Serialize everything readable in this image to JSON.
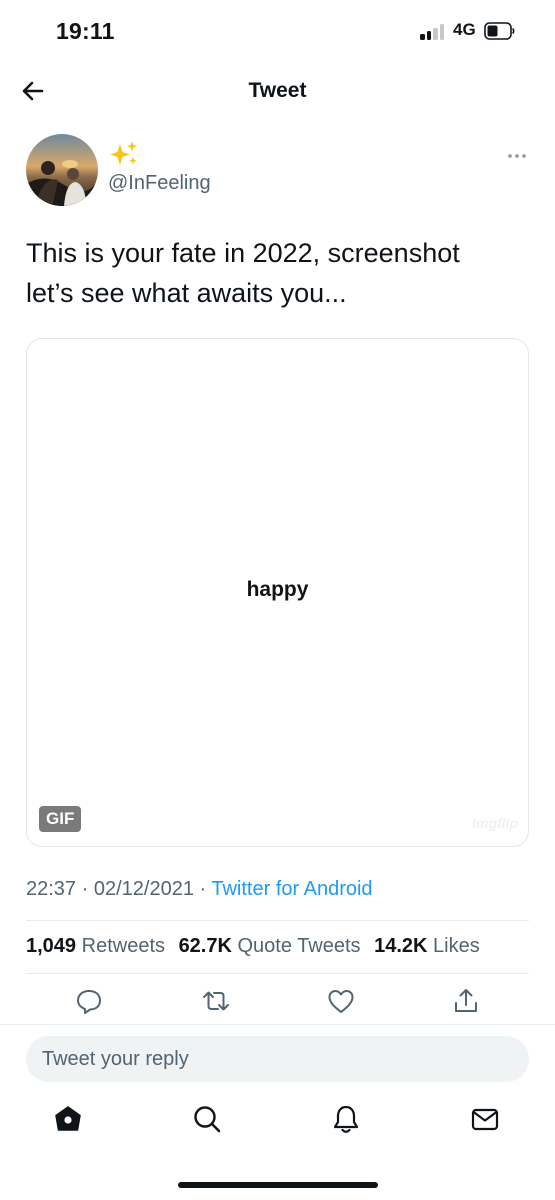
{
  "status_bar": {
    "time": "19:11",
    "network": "4G"
  },
  "header": {
    "title": "Tweet"
  },
  "tweet": {
    "author": {
      "display_name_icon": "sparkles-icon",
      "handle": "@InFeeling"
    },
    "text": "This is your fate in 2022, screenshot\nlet’s see what awaits you...",
    "media": {
      "gif_word": "happy",
      "badge": "GIF",
      "watermark": "Imgflip"
    },
    "meta": {
      "time": "22:37",
      "date": "02/12/2021",
      "source": "Twitter for Android"
    },
    "stats": {
      "retweets_count": "1,049",
      "retweets_label": "Retweets",
      "quotes_count": "62.7K",
      "quotes_label": "Quote Tweets",
      "likes_count": "14.2K",
      "likes_label": "Likes"
    }
  },
  "reply": {
    "placeholder": "Tweet your reply"
  },
  "colors": {
    "link": "#1d9bf0",
    "secondary_text": "#536471",
    "primary_text": "#0f1419",
    "sparkle": "#f5c518"
  },
  "icons": {
    "actions": [
      "reply-icon",
      "retweet-icon",
      "like-icon",
      "share-icon"
    ],
    "nav": [
      "home-icon",
      "search-icon",
      "notifications-icon",
      "messages-icon"
    ]
  }
}
